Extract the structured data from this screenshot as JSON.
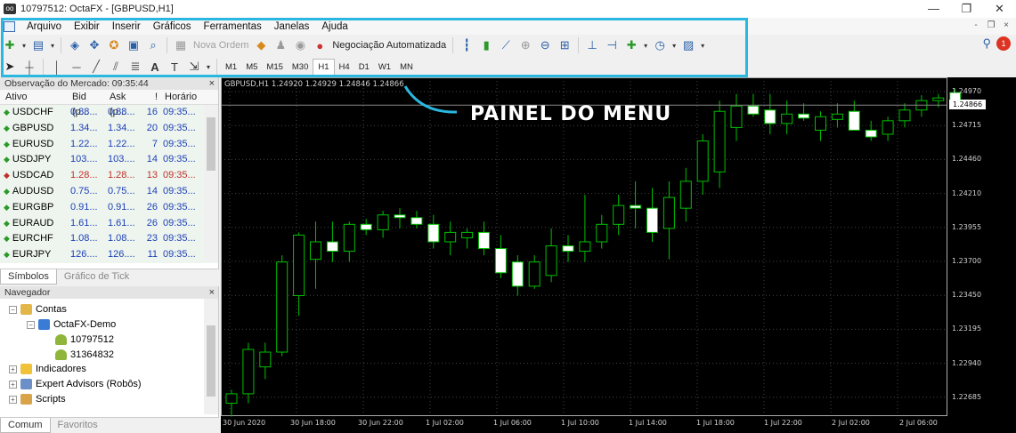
{
  "window": {
    "title": "10797512: OctaFX - [GBPUSD,H1]"
  },
  "menu": [
    "Arquivo",
    "Exibir",
    "Inserir",
    "Gráficos",
    "Ferramentas",
    "Janelas",
    "Ajuda"
  ],
  "toolbar": {
    "new_order": "Nova Ordem",
    "auto_trading": "Negociação Automatizada",
    "timeframes": [
      "M1",
      "M5",
      "M15",
      "M30",
      "H1",
      "H4",
      "D1",
      "W1",
      "MN"
    ],
    "active_timeframe": "H1",
    "notification_count": "1"
  },
  "annotation": "PAINEL DO MENU",
  "market_watch": {
    "title": "Observação do Mercado: 09:35:44",
    "columns": [
      "Ativo",
      "Bid (p...",
      "Ask (p...",
      "!",
      "Horário"
    ],
    "rows": [
      {
        "symbol": "USDCHF",
        "bid": "0.88...",
        "ask": "0.88...",
        "n": "16",
        "time": "09:35...",
        "dir": "up"
      },
      {
        "symbol": "GBPUSD",
        "bid": "1.34...",
        "ask": "1.34...",
        "n": "20",
        "time": "09:35...",
        "dir": "up"
      },
      {
        "symbol": "EURUSD",
        "bid": "1.22...",
        "ask": "1.22...",
        "n": "7",
        "time": "09:35...",
        "dir": "up"
      },
      {
        "symbol": "USDJPY",
        "bid": "103....",
        "ask": "103....",
        "n": "14",
        "time": "09:35...",
        "dir": "up"
      },
      {
        "symbol": "USDCAD",
        "bid": "1.28...",
        "ask": "1.28...",
        "n": "13",
        "time": "09:35...",
        "dir": "down"
      },
      {
        "symbol": "AUDUSD",
        "bid": "0.75...",
        "ask": "0.75...",
        "n": "14",
        "time": "09:35...",
        "dir": "up"
      },
      {
        "symbol": "EURGBP",
        "bid": "0.91...",
        "ask": "0.91...",
        "n": "26",
        "time": "09:35...",
        "dir": "up"
      },
      {
        "symbol": "EURAUD",
        "bid": "1.61...",
        "ask": "1.61...",
        "n": "26",
        "time": "09:35...",
        "dir": "up"
      },
      {
        "symbol": "EURCHF",
        "bid": "1.08...",
        "ask": "1.08...",
        "n": "23",
        "time": "09:35...",
        "dir": "up"
      },
      {
        "symbol": "EURJPY",
        "bid": "126....",
        "ask": "126....",
        "n": "11",
        "time": "09:35...",
        "dir": "up"
      }
    ],
    "tabs": [
      "Símbolos",
      "Gráfico de Tick"
    ]
  },
  "navigator": {
    "title": "Navegador",
    "accounts": "Contas",
    "server": "OctaFX-Demo",
    "account1": "10797512",
    "account2": "31364832",
    "indicators": "Indicadores",
    "experts": "Expert Advisors (Robôs)",
    "scripts": "Scripts",
    "tabs": [
      "Comum",
      "Favoritos"
    ]
  },
  "chart": {
    "info": "GBPUSD,H1  1.24920 1.24929 1.24846 1.24866",
    "current_price": "1.24866",
    "y_labels": [
      "1.24970",
      "1.24715",
      "1.24460",
      "1.24210",
      "1.23955",
      "1.23700",
      "1.23450",
      "1.23195",
      "1.22940",
      "1.22685"
    ],
    "x_labels": [
      "30 Jun 2020",
      "30 Jun 18:00",
      "30 Jun 22:00",
      "1 Jul 02:00",
      "1 Jul 06:00",
      "1 Jul 10:00",
      "1 Jul 14:00",
      "1 Jul 18:00",
      "1 Jul 22:00",
      "2 Jul 02:00",
      "2 Jul 06:00"
    ],
    "bull_color": "#00c000",
    "bear_color": "#ffffff",
    "candles": [
      [
        1.2265,
        1.2275,
        1.2255,
        1.2272
      ],
      [
        1.2272,
        1.231,
        1.2265,
        1.2305
      ],
      [
        1.2292,
        1.231,
        1.2283,
        1.2303
      ],
      [
        1.2303,
        1.2375,
        1.23,
        1.237
      ],
      [
        1.2345,
        1.2392,
        1.233,
        1.239
      ],
      [
        1.2372,
        1.24,
        1.235,
        1.2385
      ],
      [
        1.2385,
        1.24,
        1.237,
        1.2378
      ],
      [
        1.2378,
        1.24,
        1.237,
        1.2398
      ],
      [
        1.2398,
        1.2402,
        1.239,
        1.2394
      ],
      [
        1.2394,
        1.2408,
        1.2388,
        1.2405
      ],
      [
        1.2405,
        1.241,
        1.2395,
        1.2403
      ],
      [
        1.2403,
        1.2408,
        1.2395,
        1.2398
      ],
      [
        1.2398,
        1.2405,
        1.238,
        1.2385
      ],
      [
        1.2385,
        1.24,
        1.2375,
        1.2392
      ],
      [
        1.2388,
        1.2395,
        1.238,
        1.2392
      ],
      [
        1.2392,
        1.24,
        1.2375,
        1.238
      ],
      [
        1.238,
        1.239,
        1.2358,
        1.2362
      ],
      [
        1.237,
        1.2375,
        1.2345,
        1.2352
      ],
      [
        1.2352,
        1.2375,
        1.235,
        1.237
      ],
      [
        1.236,
        1.2395,
        1.2355,
        1.2382
      ],
      [
        1.2382,
        1.239,
        1.237,
        1.2378
      ],
      [
        1.2378,
        1.242,
        1.237,
        1.2385
      ],
      [
        1.2385,
        1.2405,
        1.238,
        1.2398
      ],
      [
        1.2398,
        1.242,
        1.239,
        1.2412
      ],
      [
        1.2412,
        1.243,
        1.2395,
        1.241
      ],
      [
        1.241,
        1.2425,
        1.2385,
        1.2392
      ],
      [
        1.2395,
        1.243,
        1.2372,
        1.2418
      ],
      [
        1.241,
        1.244,
        1.24,
        1.243
      ],
      [
        1.243,
        1.2465,
        1.242,
        1.246
      ],
      [
        1.2437,
        1.249,
        1.2425,
        1.2482
      ],
      [
        1.247,
        1.2495,
        1.246,
        1.2486
      ],
      [
        1.2486,
        1.2495,
        1.2478,
        1.248
      ],
      [
        1.2483,
        1.2495,
        1.2465,
        1.2473
      ],
      [
        1.2473,
        1.249,
        1.2465,
        1.248
      ],
      [
        1.248,
        1.2488,
        1.2475,
        1.2477
      ],
      [
        1.2468,
        1.2482,
        1.246,
        1.2478
      ],
      [
        1.2476,
        1.2488,
        1.247,
        1.248
      ],
      [
        1.2482,
        1.249,
        1.2475,
        1.2468
      ],
      [
        1.2468,
        1.2475,
        1.246,
        1.2463
      ],
      [
        1.2465,
        1.2478,
        1.246,
        1.2475
      ],
      [
        1.2475,
        1.2488,
        1.247,
        1.2483
      ],
      [
        1.2483,
        1.2494,
        1.2478,
        1.249
      ],
      [
        1.249,
        1.2495,
        1.2485,
        1.2492
      ],
      [
        1.2496,
        1.2499,
        1.2486,
        1.249
      ]
    ]
  }
}
